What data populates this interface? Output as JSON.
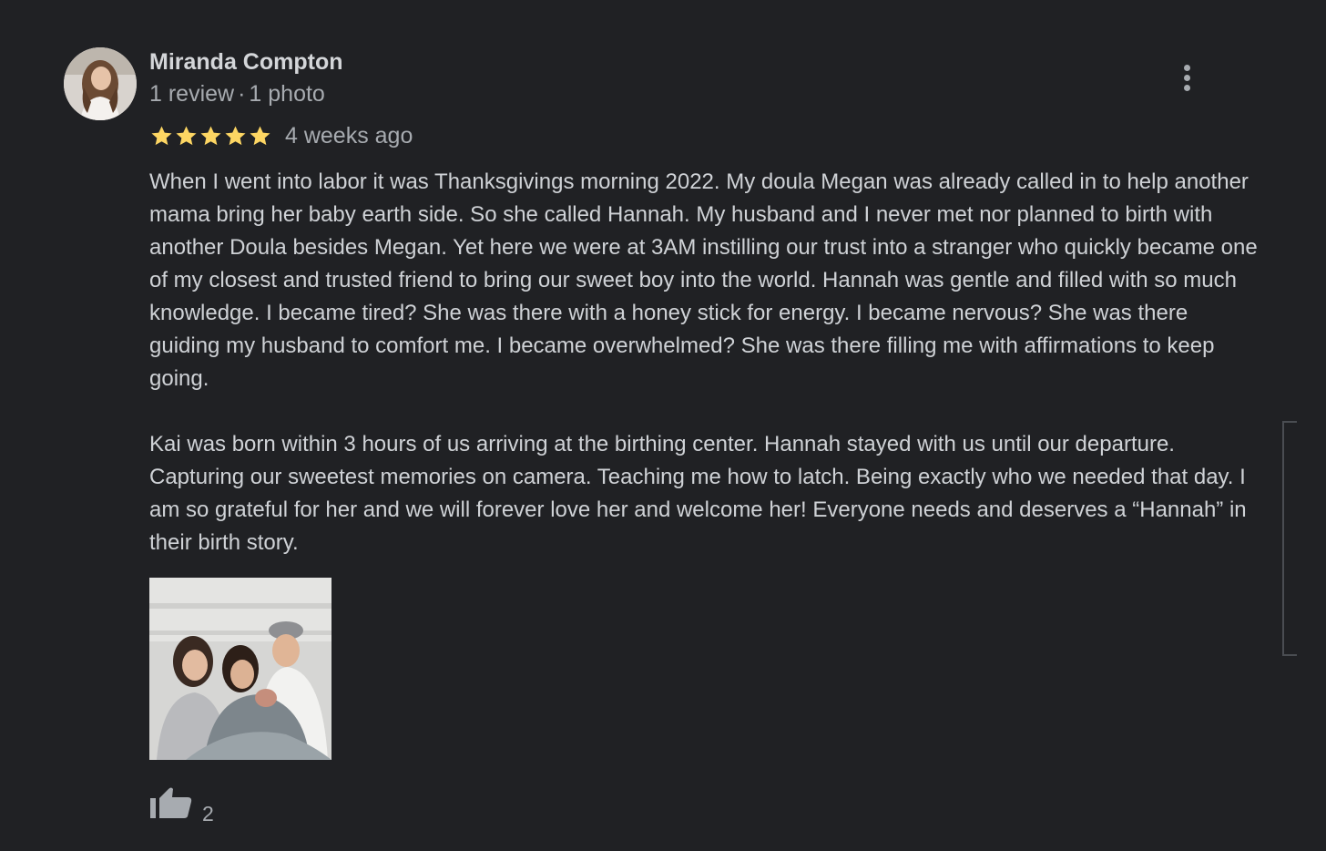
{
  "author": {
    "name": "Miranda Compton",
    "review_count": "1 review",
    "separator": "·",
    "photo_count": "1 photo"
  },
  "review": {
    "rating": 5,
    "max_rating": 5,
    "date": "4 weeks ago",
    "paragraphs": [
      "When I went into labor it was Thanksgivings morning 2022. My doula Megan was already called in to help another mama bring her baby earth side. So she called Hannah. My husband and I never met nor planned to birth with another Doula besides Megan. Yet here we were at 3AM instilling our trust into a stranger who quickly became one of my closest and trusted friend to bring our sweet boy into the world. Hannah was gentle and filled with so much knowledge. I became tired? She was there with a honey stick for energy. I became nervous? She was there guiding my husband to comfort me. I became overwhelmed? She was there filling me with affirmations to keep going.",
      "Kai was born within 3 hours of us arriving at the birthing center. Hannah stayed with us until our departure. Capturing our sweetest memories on camera. Teaching me how to latch. Being exactly who we needed that day. I am so grateful for her and we will forever love her and welcome her! Everyone needs and deserves a “Hannah” in their birth story."
    ],
    "likes": "2"
  },
  "icons": {
    "star": "star-icon",
    "more": "more-vert-icon",
    "like": "thumb-up-icon"
  },
  "colors": {
    "background": "#202124",
    "star": "#fdd663",
    "text": "#cfd2d6",
    "secondary_text": "#a7abb0"
  }
}
